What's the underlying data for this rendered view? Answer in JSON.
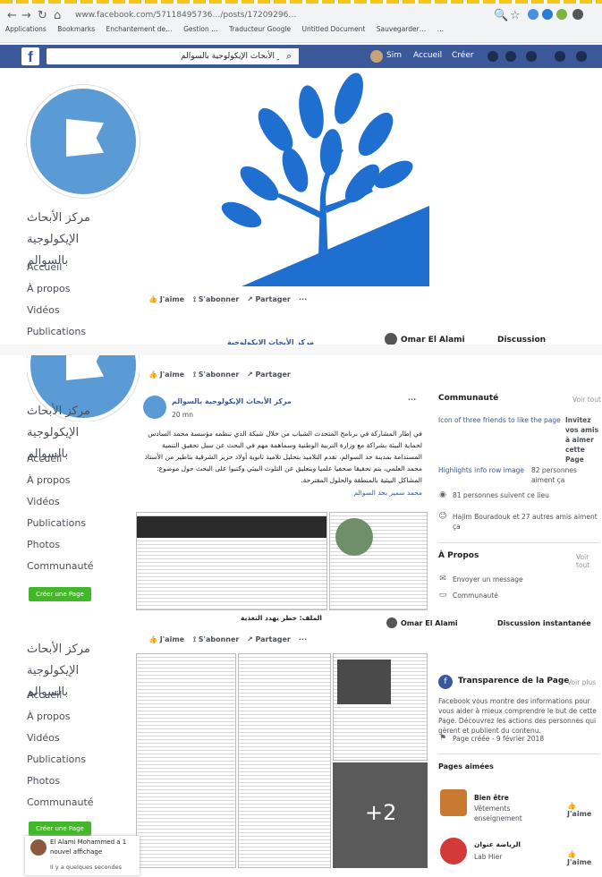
{
  "browser": {
    "url": "www.facebook.com/57118495736…/posts/17209296…",
    "bookmarks": [
      "Applications",
      "Bookmarks",
      "Enchantement de…",
      "Gestion …",
      "Traducteur Google",
      "Untitled Document",
      "Sauvegarder…",
      "…"
    ]
  },
  "fb_header": {
    "logo": "f",
    "search_value": "مركز الأبحاث الإيكولوجية بالسوالم",
    "user_name": "Sim",
    "nav_home": "Accueil",
    "nav_create": "Créer"
  },
  "page": {
    "name_line1": "مركز الأبحاث الإيكولوجية",
    "name_line2": "بالسوالم",
    "sidebar_top": [
      "Accueil",
      "À propos",
      "Vidéos",
      "Publications"
    ],
    "sidebar_mid": [
      "Accueil",
      "À propos",
      "Vidéos",
      "Publications",
      "Photos",
      "Communauté"
    ],
    "sidebar_bottom": [
      "Accueil",
      "À propos",
      "Vidéos",
      "Publications",
      "Photos",
      "Communauté"
    ],
    "create_page_label": "Créer une Page"
  },
  "actions": {
    "like": "J'aime",
    "subscribe": "S'abonner",
    "share": "Partager",
    "more": "···",
    "strip_title": "مركز الأبحاث الإيكولوجية"
  },
  "chat_strip": {
    "person": "Omar El Alami",
    "instant": "Discussion instantanée"
  },
  "post": {
    "author": "مركز الأبحاث الإيكولوجية بالسوالم",
    "time": "20 mn",
    "body": "في إطار المشاركة في برنامج المتحدث الشباب من خلال شبكة الذي تنظمه مؤسسة محمد السادس لحماية البيئة بشراكة مع وزارة التربية الوطنية وسماهمة مهم في البحث عن سبل تحقيق التنمية المستدامة بمدينة حد السوالم، تقدم التلاميذ بتحليل تلاميذ ثانوية أولاد حريز الشرقية بتاطير من الأستاذ محمد العلمي، يتم تحقيقا صحفيا علميا وبتعليق عن التلوث البيئي وكتبوا على البحث حول موضوع: المشاكل البيئية بالمنطقة والحلول المقترحة.",
    "signature": "محمد سمير بحد السوالم",
    "caption": "الملف: خطر يهدد التغذية",
    "more_photos": "+2"
  },
  "community": {
    "title": "Communauté",
    "see_all": "Voir tout",
    "invite_alt": "Icon of three friends to like the page",
    "invite_text": "Invitez vos amis à aimer cette Page",
    "highlights_alt": "Highlights info row image",
    "likes_count": "82 personnes aiment ça",
    "followers": "81 personnes suivent ce lieu",
    "friends_like": "Hajim Bouradouk et 27 autres amis aiment ça"
  },
  "about": {
    "title": "À Propos",
    "see_all": "Voir tout",
    "send_message": "Envoyer un message",
    "category": "Communauté"
  },
  "transparency": {
    "title": "Transparence de la Page",
    "see_more": "Voir plus",
    "text": "Facebook vous montre des informations pour vous aider à mieux comprendre le but de cette Page. Découvrez les actions des personnes qui gèrent et publient du contenu.",
    "created": "Page créée - 9 février 2018"
  },
  "liked_pages": {
    "title": "Pages aimées",
    "items": [
      {
        "name": "Bien être",
        "sub": "Vêtements enseignement",
        "action": "J'aime"
      },
      {
        "name": "الرياضة عنوان",
        "sub": "Lab Hier",
        "action": "J'aime"
      }
    ]
  },
  "footer_chat": {
    "person": "El Alami Mohammed a 1 nouvel affichage",
    "sub": "Il y a quelques secondes"
  },
  "colors": {
    "fb_blue": "#3b5998",
    "logo_blue": "#1e6fd0",
    "green": "#42b72a"
  }
}
